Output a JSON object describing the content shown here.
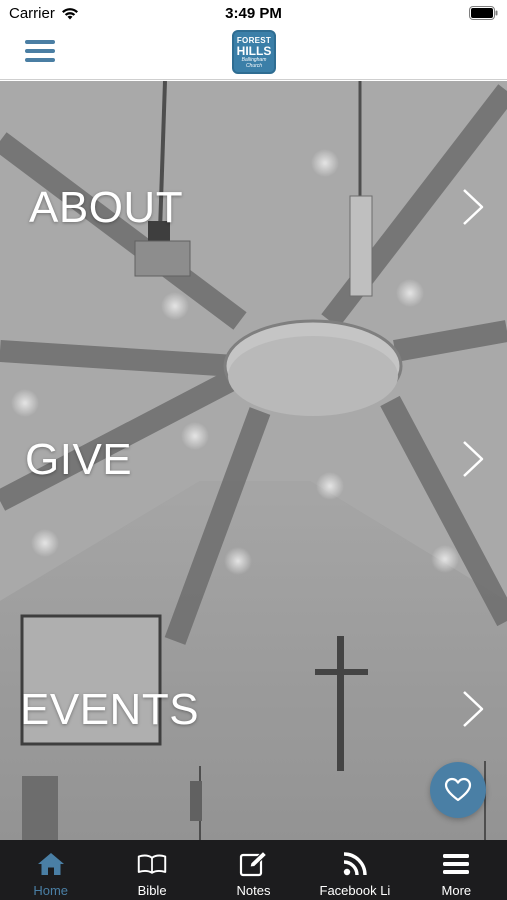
{
  "status_bar": {
    "carrier": "Carrier",
    "time": "3:49 PM"
  },
  "header": {
    "logo": {
      "line1": "FOREST",
      "line2": "HILLS",
      "line3": "Ballingham Church"
    }
  },
  "colors": {
    "accent": "#4a7fa5",
    "tab_bar_bg": "#1c1c1e",
    "hero_tint": "#9a9a9a"
  },
  "nav_items": [
    {
      "label": "ABOUT",
      "icon": "chevron-right-icon"
    },
    {
      "label": "GIVE",
      "icon": "chevron-right-icon"
    },
    {
      "label": "EVENTS",
      "icon": "chevron-right-icon"
    }
  ],
  "fab": {
    "icon": "heart-icon"
  },
  "tabs": [
    {
      "label": "Home",
      "icon": "home-icon",
      "active": true
    },
    {
      "label": "Bible",
      "icon": "book-icon",
      "active": false
    },
    {
      "label": "Notes",
      "icon": "edit-note-icon",
      "active": false
    },
    {
      "label": "Facebook Li",
      "icon": "rss-icon",
      "active": false
    },
    {
      "label": "More",
      "icon": "hamburger-icon",
      "active": false
    }
  ]
}
